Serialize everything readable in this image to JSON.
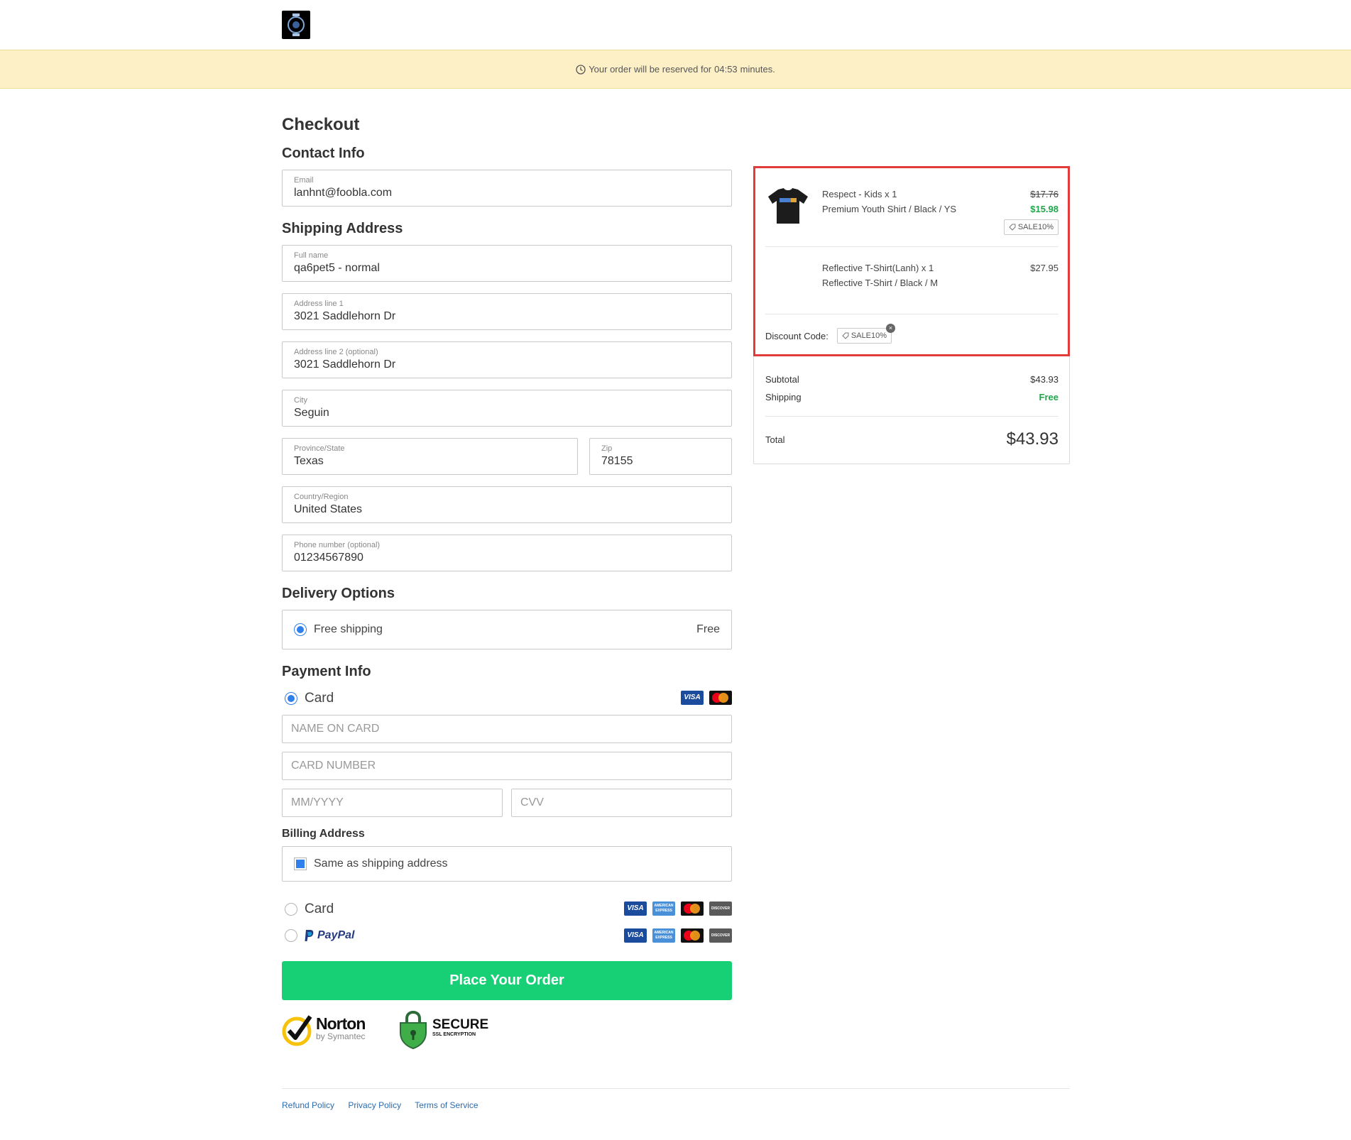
{
  "banner": {
    "prefix": "Your order will be reserved for",
    "timer": "04:53",
    "suffix": "minutes."
  },
  "checkout": {
    "title": "Checkout"
  },
  "contact": {
    "title": "Contact Info",
    "email_label": "Email",
    "email_value": "lanhnt@foobla.com"
  },
  "shipping": {
    "title": "Shipping Address",
    "fullname_label": "Full name",
    "fullname_value": "qa6pet5 - normal",
    "address1_label": "Address line 1",
    "address1_value": "3021 Saddlehorn Dr",
    "address2_label": "Address line 2 (optional)",
    "address2_value": "3021 Saddlehorn Dr",
    "city_label": "City",
    "city_value": "Seguin",
    "state_label": "Province/State",
    "state_value": "Texas",
    "zip_label": "Zip",
    "zip_value": "78155",
    "country_label": "Country/Region",
    "country_value": "United States",
    "phone_label": "Phone number (optional)",
    "phone_value": "01234567890"
  },
  "delivery": {
    "title": "Delivery Options",
    "option_label": "Free shipping",
    "option_price": "Free"
  },
  "payment": {
    "title": "Payment Info",
    "card_label": "Card",
    "name_placeholder": "NAME ON CARD",
    "number_placeholder": "CARD NUMBER",
    "expiry_placeholder": "MM/YYYY",
    "cvv_placeholder": "CVV",
    "billing_title": "Billing Address",
    "same_as_shipping": "Same as shipping address",
    "alt_card_label": "Card",
    "paypal_label": "PayPal"
  },
  "card_brands": {
    "visa": "VISA",
    "amex": "AMERICAN EXPRESS",
    "discover": "DISCOVER"
  },
  "place_order": "Place Your Order",
  "trust": {
    "norton": "Norton",
    "norton_sub": "by Symantec",
    "secure": "SECURE",
    "secure_sub": "SSL ENCRYPTION"
  },
  "footer": {
    "links": [
      "Refund Policy",
      "Privacy Policy",
      "Terms of Service"
    ]
  },
  "summary": {
    "items": [
      {
        "name": "Respect - Kids x 1",
        "variant": "Premium Youth Shirt / Black / YS",
        "original_price": "$17.76",
        "price": "$15.98",
        "tag": "SALE10%"
      },
      {
        "name": "Reflective T-Shirt(Lanh) x 1",
        "variant": "Reflective T-Shirt / Black / M",
        "price": "$27.95"
      }
    ],
    "discount_label": "Discount Code:",
    "discount_code": "SALE10%",
    "subtotal_label": "Subtotal",
    "subtotal_value": "$43.93",
    "shipping_label": "Shipping",
    "shipping_value": "Free",
    "total_label": "Total",
    "total_value": "$43.93"
  },
  "colors": {
    "accent": "#2f80ed",
    "cta": "#17cf74",
    "banner_bg": "#fdf0c7",
    "highlight": "#e23b3b",
    "price_green": "#1fa64a"
  }
}
